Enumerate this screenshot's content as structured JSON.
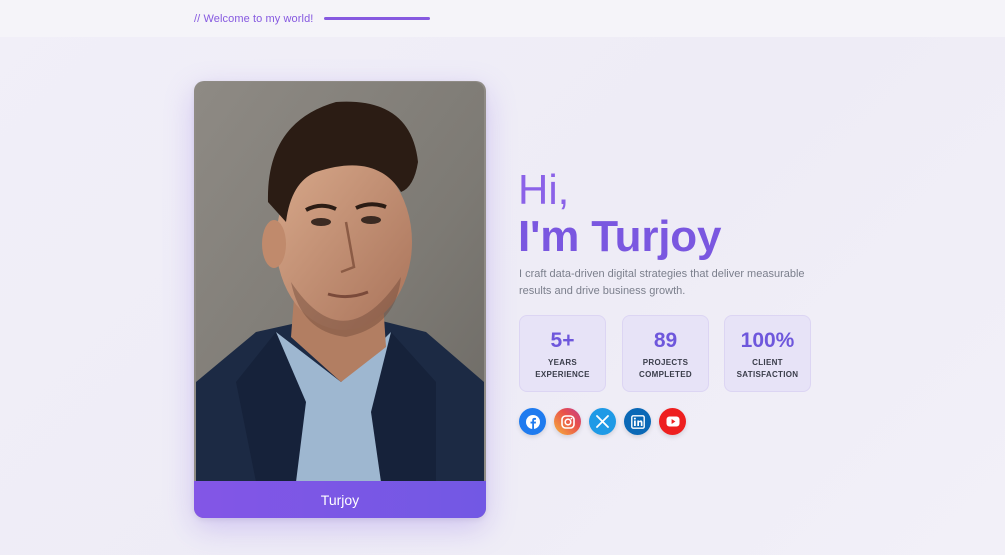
{
  "header": {
    "welcome_text": "// Welcome to my world!"
  },
  "profile": {
    "photo_alt": "Portrait of Turjoy",
    "name_caption": "Turjoy"
  },
  "hero": {
    "greeting": "Hi,",
    "name_line": "I'm Turjoy",
    "tagline": "I craft data-driven digital strategies that deliver measurable results and drive business growth."
  },
  "stats": [
    {
      "value": "5+",
      "label": "YEARS\nEXPERIENCE"
    },
    {
      "value": "89",
      "label": "PROJECTS\nCOMPLETED"
    },
    {
      "value": "100%",
      "label": "CLIENT\nSATISFACTION"
    }
  ],
  "socials": [
    {
      "name": "facebook-icon",
      "color": "#1f7bef"
    },
    {
      "name": "instagram-icon",
      "color": "#f0683f"
    },
    {
      "name": "x-twitter-icon",
      "color": "#1f9ae6"
    },
    {
      "name": "linkedin-icon",
      "color": "#0a68b6"
    },
    {
      "name": "youtube-icon",
      "color": "#ee1f1f"
    }
  ],
  "colors": {
    "accent": "#8659e0",
    "accent_dark": "#7a57e0",
    "stat_bg": "#e7e3f7"
  }
}
